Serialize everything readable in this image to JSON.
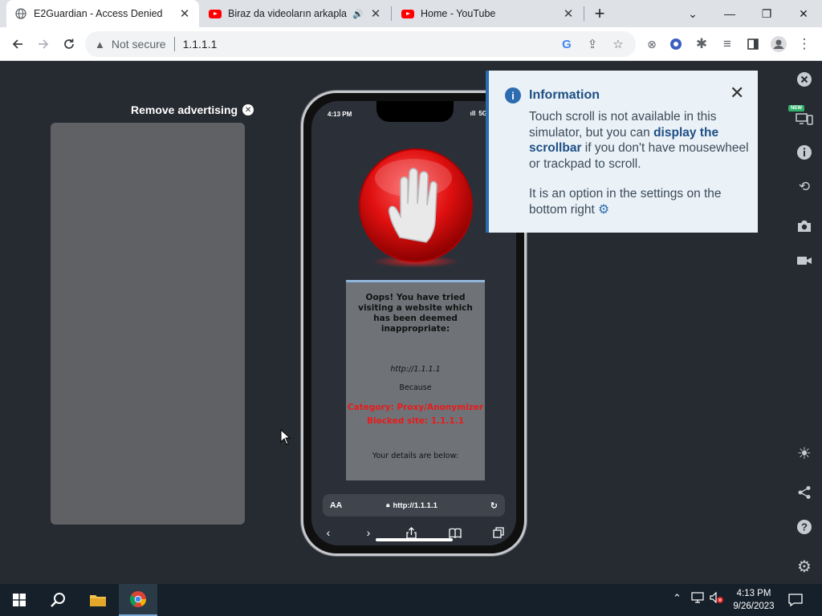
{
  "browser": {
    "tabs": [
      {
        "label": "E2Guardian - Access Denied",
        "icon": "globe-icon",
        "active": true
      },
      {
        "label": "Biraz da videoların arkaplanı",
        "icon": "youtube-icon",
        "audio": true,
        "active": false
      },
      {
        "label": "Home - YouTube",
        "icon": "youtube-icon",
        "active": false
      }
    ],
    "new_tab": "+",
    "window_controls": {
      "minimize": "—",
      "restore": "❐",
      "close": "✕",
      "dropdown": "⌄"
    },
    "omnibox": {
      "security_label": "Not secure",
      "url": "1.1.1.1"
    }
  },
  "page": {
    "remove_ad_label": "Remove advertising",
    "phone": {
      "time": "4:13 PM",
      "network": "5G",
      "block_message": "Oops! You have tried visiting a website which has been deemed inappropriate:",
      "blocked_url": "http://1.1.1.1",
      "because": "Because",
      "category": "Category: Proxy/Anonymizer",
      "blocked_site": "Blocked site: 1.1.1.1",
      "details": "Your details are below:",
      "address_bar": {
        "aa": "AA",
        "url": "http://1.1.1.1"
      }
    },
    "info_popup": {
      "title": "Information",
      "text_part1": "Touch scroll is not available in this simulator, but you can ",
      "text_link": "display the scrollbar",
      "text_part2": " if you don't have mousewheel or trackpad to scroll.",
      "text_option": "It is an option in the settings on the bottom right",
      "new_badge": "NEW"
    }
  },
  "taskbar": {
    "time": "4:13 PM",
    "date": "9/26/2023"
  },
  "colors": {
    "page_bg": "#262a31",
    "popup_bg": "#eaf2f8",
    "popup_accent": "#2d6cb0",
    "stop_red": "#e01010",
    "blocked_text": "#e81b1b"
  }
}
